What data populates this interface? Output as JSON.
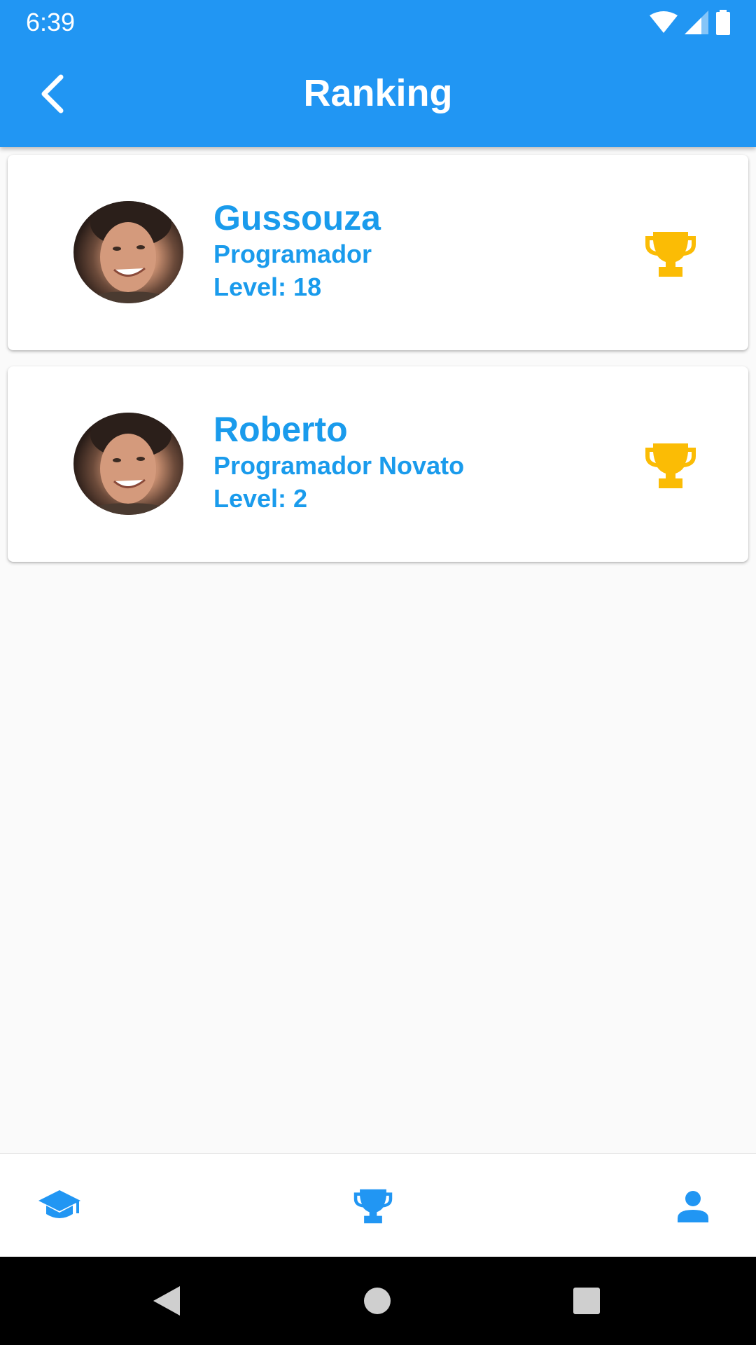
{
  "status_bar": {
    "time": "6:39"
  },
  "app_bar": {
    "title": "Ranking",
    "back_icon": "arrow-back-icon"
  },
  "ranking": [
    {
      "name": "Gussouza",
      "role": "Programador",
      "level": "Level: 18",
      "trophy_icon": "trophy-icon"
    },
    {
      "name": "Roberto",
      "role": "Programador Novato",
      "level": "Level: 2",
      "trophy_icon": "trophy-icon"
    }
  ],
  "bottom_nav": {
    "items": [
      {
        "icon": "graduation-cap-icon"
      },
      {
        "icon": "trophy-icon"
      },
      {
        "icon": "person-icon"
      }
    ]
  },
  "colors": {
    "primary": "#2196f3",
    "text_accent": "#1a9bec",
    "trophy": "#fbbc05",
    "background": "#fafafa"
  }
}
